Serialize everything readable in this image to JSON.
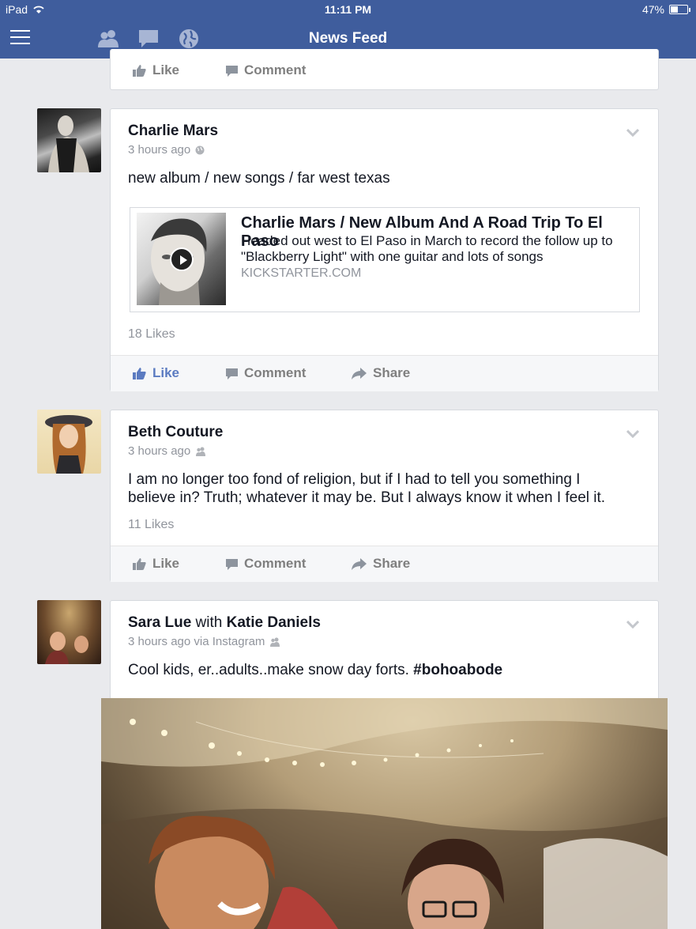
{
  "status_bar": {
    "device": "iPad",
    "time": "11:11 PM",
    "battery": "47%",
    "battery_level": 0.47
  },
  "nav": {
    "title": "News Feed",
    "icons": [
      "menu-icon",
      "friend-requests-icon",
      "messages-icon",
      "notifications-globe-icon"
    ]
  },
  "top_card": {
    "like": "Like",
    "comment": "Comment"
  },
  "posts": [
    {
      "author": "Charlie Mars",
      "time": "3 hours ago",
      "privacy_icon": "globe-icon",
      "text": "new album / new songs / far west texas",
      "link": {
        "title": "Charlie Mars / New Album And A Road Trip To El Paso",
        "description": "Headed out west to El Paso in March to record the follow up to \"Blackberry Light\" with one guitar and lots of songs",
        "domain": "KICKSTARTER.COM"
      },
      "likes": "18 Likes",
      "actions": {
        "like": "Like",
        "comment": "Comment",
        "share": "Share"
      }
    },
    {
      "author": "Beth Couture",
      "time": "3 hours ago",
      "privacy_icon": "friends-icon",
      "text": "I am no longer too fond of religion, but if I had to tell you something I believe in? Truth; whatever it may be. But I always know it when I feel it.",
      "likes": "11 Likes",
      "actions": {
        "like": "Like",
        "comment": "Comment",
        "share": "Share"
      }
    },
    {
      "author": "Sara Lue",
      "with_word": "with",
      "tagged": "Katie Daniels",
      "time": "3 hours ago via Instagram",
      "privacy_icon": "friends-icon",
      "text": "Cool kids, er..adults..make snow day forts. ",
      "hashtag": "#bohoabode"
    }
  ]
}
